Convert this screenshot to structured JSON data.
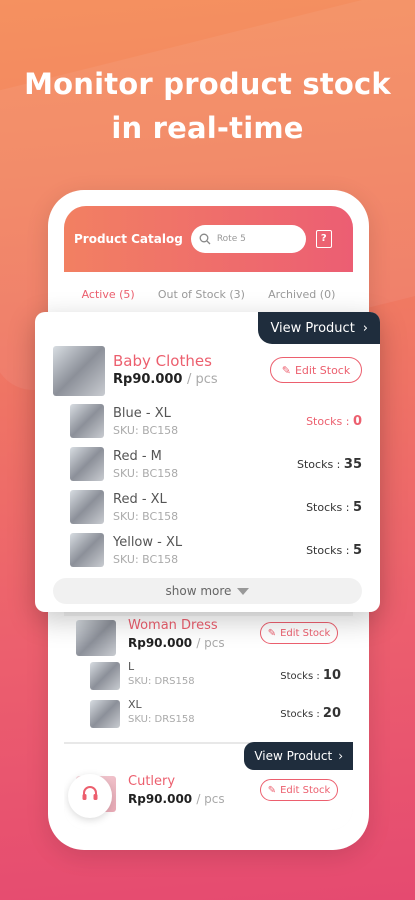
{
  "headline": {
    "line1": "Monitor product stock",
    "line2": "in real-time"
  },
  "header": {
    "title": "Product Catalog",
    "search_placeholder": "Rote 5"
  },
  "tabs": [
    {
      "label": "Active (5)",
      "active": true
    },
    {
      "label": "Out of Stock (3)",
      "active": false
    },
    {
      "label": "Archived (0)",
      "active": false
    }
  ],
  "popup": {
    "view_product": "View Product",
    "product_name": "Baby Clothes",
    "price": "Rp90.000",
    "unit": "/ pcs",
    "edit_stock": "Edit Stock",
    "variants": [
      {
        "name": "Blue - XL",
        "sku": "SKU: BC158",
        "stock_label": "Stocks :",
        "stock": "0"
      },
      {
        "name": "Red - M",
        "sku": "SKU: BC158",
        "stock_label": "Stocks :",
        "stock": "35"
      },
      {
        "name": "Red - XL",
        "sku": "SKU: BC158",
        "stock_label": "Stocks :",
        "stock": "5"
      },
      {
        "name": "Yellow - XL",
        "sku": "SKU: BC158",
        "stock_label": "Stocks :",
        "stock": "5"
      }
    ],
    "show_more": "show more"
  },
  "list": {
    "product2": {
      "name": "Woman Dress",
      "price": "Rp90.000",
      "unit": "/ pcs",
      "edit_stock": "Edit Stock",
      "variants": [
        {
          "name": "L",
          "sku": "SKU: DRS158",
          "stock_label": "Stocks :",
          "stock": "10"
        },
        {
          "name": "XL",
          "sku": "SKU: DRS158",
          "stock_label": "Stocks :",
          "stock": "20"
        }
      ]
    },
    "product3": {
      "view_product": "View Product",
      "name": "Cutlery",
      "price": "Rp90.000",
      "unit": "/ pcs",
      "edit_stock": "Edit Stock"
    }
  },
  "colors": {
    "accent": "#ec5f6e",
    "dark_tag": "#1f2d3d",
    "gradient_top": "#f59160",
    "gradient_bottom": "#e54a70"
  },
  "icons": {
    "search": "search-icon",
    "catalog": "catalog-icon",
    "edit": "pencil-icon",
    "support": "headset-icon",
    "chevron": "chevron-right-icon",
    "show_more": "caret-down-icon"
  }
}
